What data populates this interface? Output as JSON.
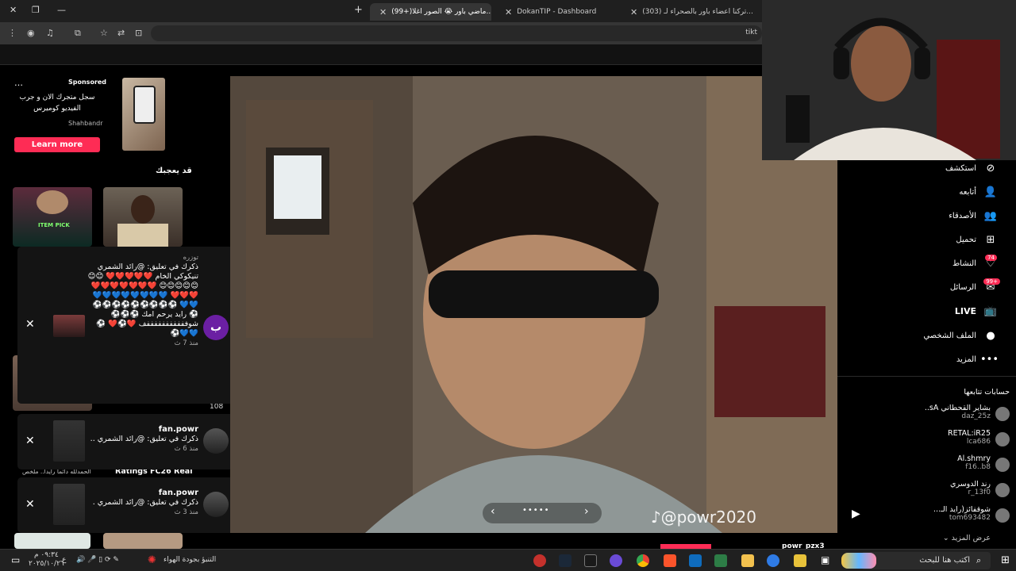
{
  "browser": {
    "tabs": [
      {
        "label": "(303) تركنا اعضاء باور بالصحراء لـ..."
      },
      {
        "label": "DokanTIP - Dashboard"
      },
      {
        "label": "(99+)ماضي باور 😭 الصور اغلا..."
      }
    ],
    "url": "tikt"
  },
  "sponsored": {
    "label": "Sponsored",
    "text": "سجل متجرك الان و جرب الفيديو كوميرس",
    "brand": "Shahbandr",
    "cta": "Learn more"
  },
  "suggested": {
    "title": "قد يعجبك",
    "card1_text": "ITEM PICK",
    "card3_caption": "Ratings FC26 Real",
    "card3_sub": "الحمدلله دائما رايدا.. ملخص",
    "card_count": "108"
  },
  "notifications": [
    {
      "name": "توزره",
      "text": "ذكرك في تعليق: @رائد الشمري تنيكوكي الخام ❤️❤️❤️❤️❤️ 😊😊😊😊😊😊😊 ❤️❤️❤️❤️❤️❤️❤️❤️❤️❤️ 💙💙💙💙💙💙💙💙💙💙 ⚽⚽⚽⚽⚽⚽⚽⚽⚽⚽ رايد يرحم امك ⚽⚽⚽ شوفففففففففففف ❤️⚽❤️ ⚽💙💙⚽",
      "time": "منذ 7 ث",
      "avatar_letter": "ب"
    },
    {
      "name": "fan.powr",
      "text": "ذكرك في تعليق: @رائد الشمري ..",
      "time": "منذ 6 ث"
    },
    {
      "name": "fan.powr",
      "text": "ذكرك في تعليق: @رائد الشمري .",
      "time": "منذ 3 ث"
    }
  ],
  "video": {
    "watermark": "@powr2020",
    "author": "powr_pzx3"
  },
  "nav": {
    "explore": "استكشف",
    "following": "أتابعه",
    "friends": "الأصدقاء",
    "upload": "تحميل",
    "activity": "النشاط",
    "activity_badge": "74",
    "messages": "الرسائل",
    "messages_badge": "99+",
    "live": "LIVE",
    "profile": "الملف الشخصي",
    "more": "المزيد"
  },
  "following_accounts": {
    "title": "حسابات تتابعها",
    "accounts": [
      {
        "name": "بشاير القحطاني sA..",
        "handle": "daz_25z"
      },
      {
        "name": "RETAL:iR25",
        "handle": "lca686"
      },
      {
        "name": "Al.shmry",
        "handle": "f16..b8"
      },
      {
        "name": "رند الدوسري",
        "handle": "r_13f0"
      },
      {
        "name": "شوقفائز(رايد الـ...",
        "handle": "tom693482"
      }
    ],
    "see_more": "عرض المزيد"
  },
  "taskbar": {
    "search_placeholder": "اكتب هنا للبحث",
    "weather": "التنبؤ بجودة الهواء",
    "time": "٠٩:٣٤ م",
    "date": "٢٠٢٥/١٠/٢٦",
    "lang": "ع"
  }
}
